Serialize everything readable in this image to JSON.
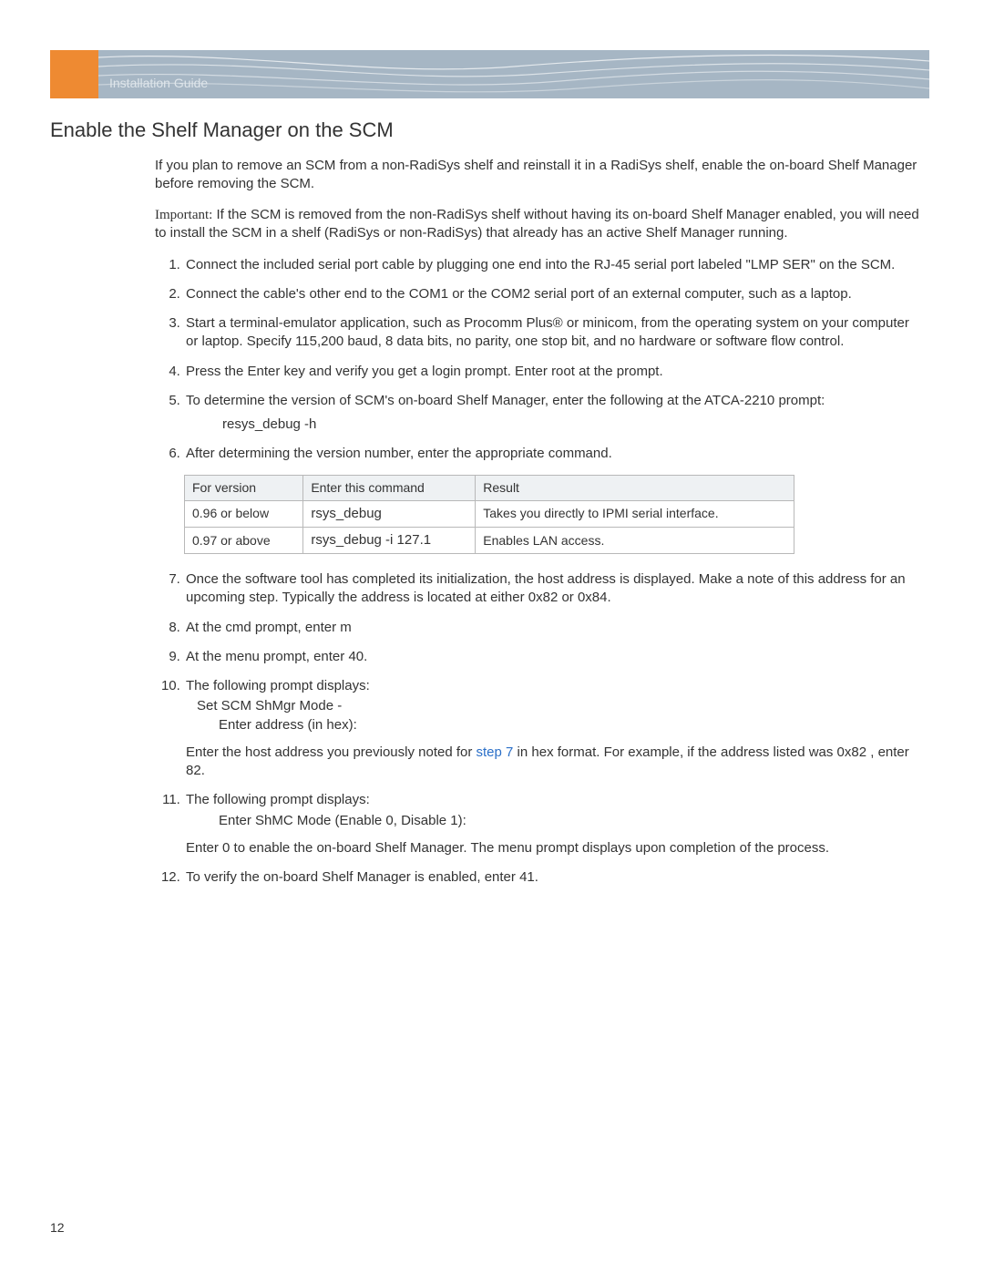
{
  "banner": {
    "label": "Installation Guide"
  },
  "title": "Enable the Shelf Manager on the SCM",
  "intro": "If you plan to remove an SCM from a non-RadiSys shelf and reinstall it in a RadiSys shelf, enable the on-board Shelf Manager before removing the SCM.",
  "important_label": "Important:",
  "important_text": " If the SCM is removed from the non-RadiSys shelf without having its on-board Shelf Manager enabled, you will need to install the SCM in a shelf (RadiSys or non-RadiSys) that already has an active Shelf Manager running.",
  "steps": {
    "s1": "Connect the included serial port cable by plugging one end into the RJ-45 serial port labeled \"LMP SER\" on the SCM.",
    "s2": "Connect the cable's other end to the COM1 or the COM2 serial port of an external computer, such as a laptop.",
    "s3": "Start a terminal-emulator application, such as Procomm Plus® or minicom, from the operating system on your computer or laptop. Specify 115,200 baud, 8 data bits, no parity, one stop bit, and no hardware or software flow control.",
    "s4_a": "Press the Enter key and verify you get a ",
    "s4_login": "login",
    "s4_b": " prompt. Enter ",
    "s4_root": "root",
    "s4_c": " at the prompt.",
    "s5": "To determine the version of SCM's on-board Shelf Manager, enter the following at the ATCA-2210 prompt:",
    "s5_code": "resys_debug -h",
    "s6": "After determining the version number, enter the appropriate command.",
    "s7": "Once the software tool has completed its initialization, the host address is displayed. Make a note of this address for an upcoming step. Typically the address is located at either 0x82 or 0x84.",
    "s8_a": "At the ",
    "s8_cmd": "cmd",
    "s8_b": " prompt, enter ",
    "s8_m": "m",
    "s9_a": "At the ",
    "s9_menu": "menu",
    "s9_b": " prompt, enter ",
    "s9_40": "40",
    "s9_c": ".",
    "s10_a": "The following prompt displays:",
    "s10_p1": "Set SCM ShMgr Mode -",
    "s10_p2": "Enter address (in hex):",
    "s10_b1": "Enter the host address you previously noted for ",
    "s10_link": "step 7",
    "s10_b2": " in hex format. For example, if the address listed was 0x82 , enter ",
    "s10_82": "82",
    "s10_b3": ".",
    "s11_a": "The following prompt displays:",
    "s11_p": "Enter ShMC Mode (Enable 0, Disable 1):",
    "s11_b1": "Enter ",
    "s11_zero": "0",
    "s11_b2": " to enable the on-board Shelf Manager. The ",
    "s11_menu": "menu",
    "s11_b3": " prompt displays upon completion of the process.",
    "s12_a": "To verify the on-board Shelf Manager is enabled, enter ",
    "s12_41": "41",
    "s12_b": "."
  },
  "table": {
    "headers": {
      "c1": "For version",
      "c2": "Enter this command",
      "c3": "Result"
    },
    "rows": [
      {
        "version": "0.96 or below",
        "command": "rsys_debug",
        "result": "Takes you directly to IPMI serial interface."
      },
      {
        "version": "0.97 or above",
        "command": "rsys_debug -i 127.1",
        "result": "Enables LAN access."
      }
    ]
  },
  "page_number": "12"
}
